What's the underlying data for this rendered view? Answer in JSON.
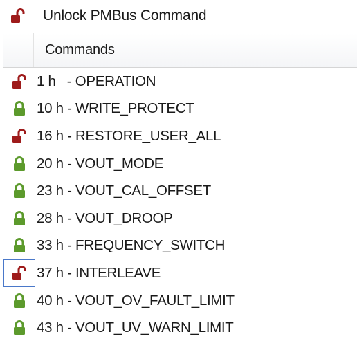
{
  "unlock_button": {
    "label": "Unlock PMBus Command",
    "icon": "unlocked-padlock-icon"
  },
  "table": {
    "column_header": "Commands",
    "rows": [
      {
        "text": "1 h   - OPERATION",
        "state": "unlocked"
      },
      {
        "text": "10 h - WRITE_PROTECT",
        "state": "locked"
      },
      {
        "text": "16 h - RESTORE_USER_ALL",
        "state": "unlocked"
      },
      {
        "text": "20 h - VOUT_MODE",
        "state": "locked"
      },
      {
        "text": "23 h - VOUT_CAL_OFFSET",
        "state": "locked"
      },
      {
        "text": "28 h - VOUT_DROOP",
        "state": "locked"
      },
      {
        "text": "33 h - FREQUENCY_SWITCH",
        "state": "locked"
      },
      {
        "text": "37 h - INTERLEAVE",
        "state": "unlocked",
        "focused": true
      },
      {
        "text": "40 h - VOUT_OV_FAULT_LIMIT",
        "state": "locked"
      },
      {
        "text": "43 h - VOUT_UV_WARN_LIMIT",
        "state": "locked"
      }
    ]
  },
  "colors": {
    "locked": "#5c9a2c",
    "unlocked": "#9e1b1b",
    "focus_border": "#4a78c9"
  }
}
